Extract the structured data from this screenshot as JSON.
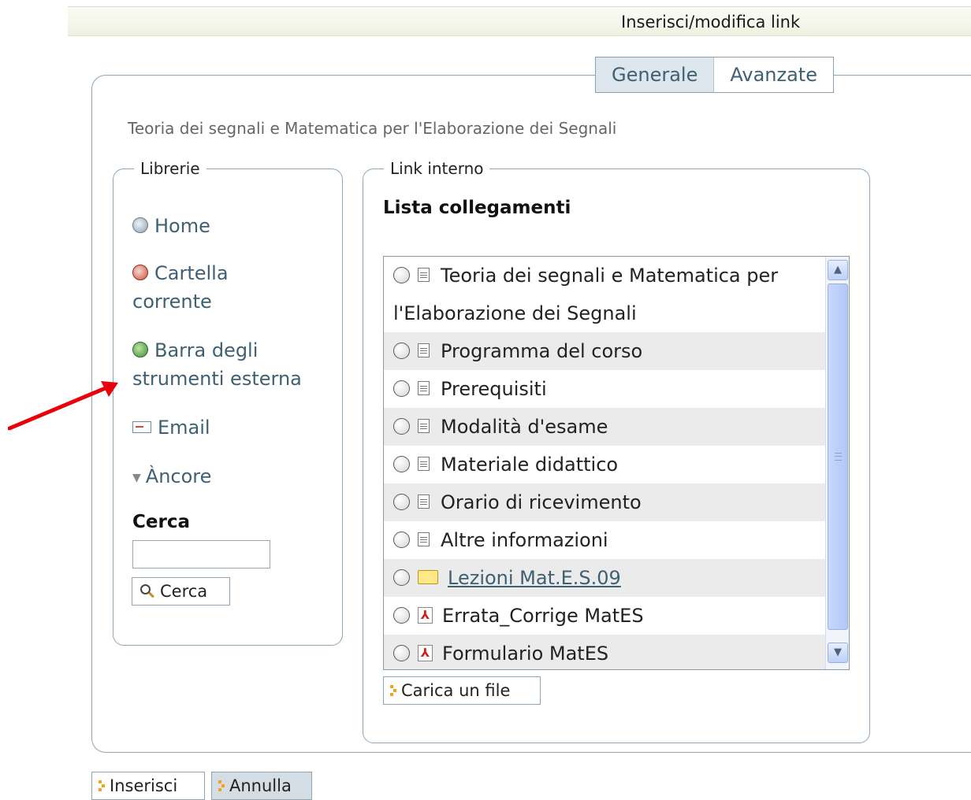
{
  "window": {
    "title": "Inserisci/modifica link"
  },
  "tabs": [
    {
      "label": "Generale",
      "active": true
    },
    {
      "label": "Avanzate",
      "active": false
    }
  ],
  "breadcrumb": "Teoria dei segnali e Matematica per l'Elaborazione dei Segnali",
  "libraries": {
    "legend": "Librerie",
    "items": [
      {
        "label": "Home",
        "icon": "home-icon"
      },
      {
        "label": "Cartella corrente",
        "icon": "current-folder-icon"
      },
      {
        "label": "Barra degli strumenti esterna",
        "icon": "globe-icon"
      },
      {
        "label": "Email",
        "icon": "email-icon"
      },
      {
        "label": "Àncore",
        "icon": "anchor-icon"
      }
    ],
    "search": {
      "title": "Cerca",
      "value": "",
      "button_label": "Cerca"
    }
  },
  "internal_link": {
    "legend": "Link interno",
    "list_title": "Lista collegamenti",
    "items": [
      {
        "label": "Teoria dei segnali e Matematica per l'Elaborazione dei Segnali",
        "type": "document"
      },
      {
        "label": "Programma del corso",
        "type": "document"
      },
      {
        "label": "Prerequisiti",
        "type": "document"
      },
      {
        "label": "Modalità d'esame",
        "type": "document"
      },
      {
        "label": "Materiale didattico",
        "type": "document"
      },
      {
        "label": "Orario di ricevimento",
        "type": "document"
      },
      {
        "label": "Altre informazioni",
        "type": "document"
      },
      {
        "label": "Lezioni Mat.E.S.09",
        "type": "folder"
      },
      {
        "label": "Errata_Corrige MatES",
        "type": "pdf"
      },
      {
        "label": "Formulario MatES",
        "type": "pdf"
      }
    ],
    "upload_label": "Carica un file"
  },
  "footer": {
    "insert_label": "Inserisci",
    "cancel_label": "Annulla"
  },
  "colors": {
    "accent": "#3f6073",
    "border": "#8fa5b4",
    "annotation_arrow": "#e8000b"
  }
}
